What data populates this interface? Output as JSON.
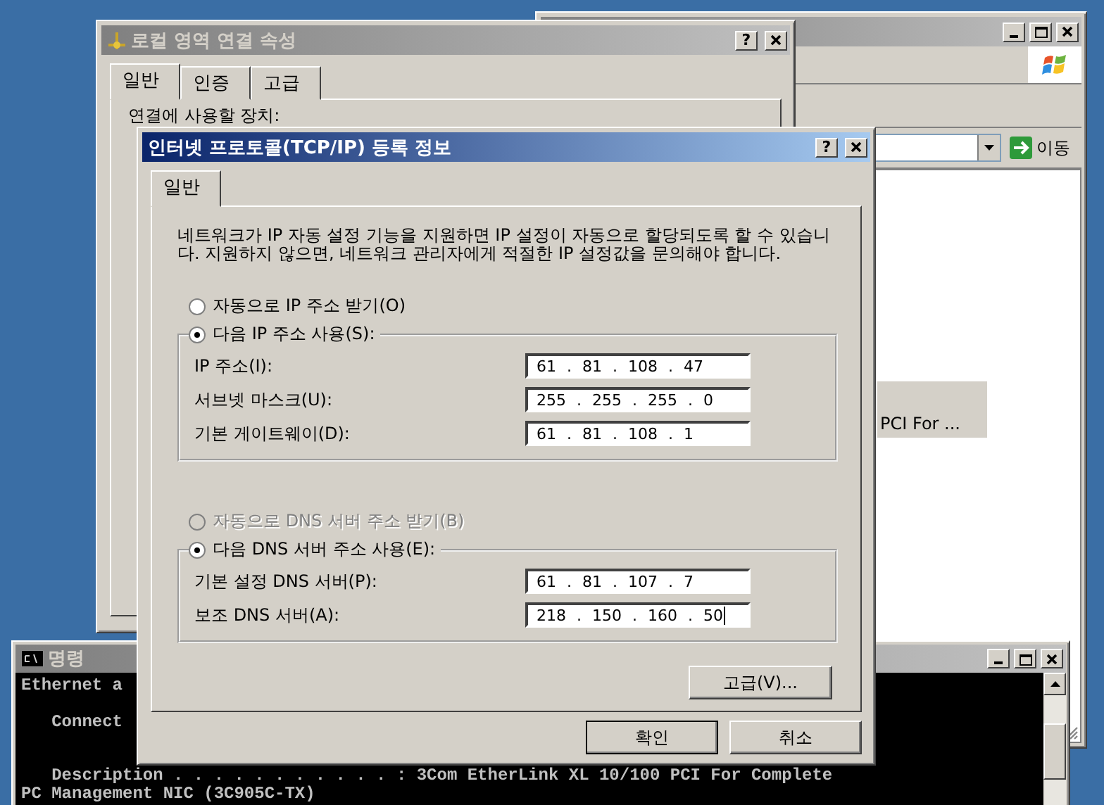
{
  "explorer_window": {
    "active": false,
    "go_button": "이동",
    "list_item": {
      "text": "PCI For ...",
      "selected": true
    }
  },
  "properties_dialog": {
    "title": "로컬 영역 연결 속성",
    "active": false,
    "help_button": "?",
    "tabs": [
      {
        "label": "일반",
        "selected": true
      },
      {
        "label": "인증",
        "selected": false
      },
      {
        "label": "고급",
        "selected": false
      }
    ],
    "device_label": "연결에 사용할 장치:"
  },
  "tcpip_dialog": {
    "title": "인터넷 프로토콜(TCP/IP) 등록 정보",
    "active": true,
    "help_button": "?",
    "tabs": [
      {
        "label": "일반",
        "selected": true
      }
    ],
    "description": "네트워크가 IP 자동 설정 기능을 지원하면 IP 설정이 자동으로 할당되도록 할 수 있습니다. 지원하지 않으면, 네트워크 관리자에게 적절한 IP 설정값을 문의해야 합니다.",
    "ip_options": [
      {
        "label": "자동으로 IP 주소 받기(O)",
        "selected": false,
        "disabled": false
      },
      {
        "label": "다음 IP 주소 사용(S):",
        "selected": true,
        "disabled": false
      }
    ],
    "ip_fields": [
      {
        "label": "IP 주소(I):",
        "value": "61 . 81 . 108 . 47",
        "focused": false
      },
      {
        "label": "서브넷 마스크(U):",
        "value": "255 . 255 . 255 . 0",
        "focused": false
      },
      {
        "label": "기본 게이트웨이(D):",
        "value": "61 . 81 . 108 . 1",
        "focused": false
      }
    ],
    "dns_options": [
      {
        "label": "자동으로 DNS 서버 주소 받기(B)",
        "selected": false,
        "disabled": true
      },
      {
        "label": "다음 DNS 서버 주소 사용(E):",
        "selected": true,
        "disabled": false
      }
    ],
    "dns_fields": [
      {
        "label": "기본 설정 DNS 서버(P):",
        "value": "61 . 81 . 107 . 7",
        "focused": false
      },
      {
        "label": "보조 DNS 서버(A):",
        "value": "218 . 150 . 160 . 50",
        "focused": true
      }
    ],
    "advanced_button": "고급(V)...",
    "buttons": [
      "확인",
      "취소"
    ]
  },
  "console_window": {
    "title": "명령",
    "active": false,
    "lines": [
      "Ethernet a",
      "   Connect",
      "   Description . . . . . . . . . . . : 3Com EtherLink XL 10/100 PCI For Complete",
      "PC Management NIC (3C905C-TX)"
    ]
  }
}
